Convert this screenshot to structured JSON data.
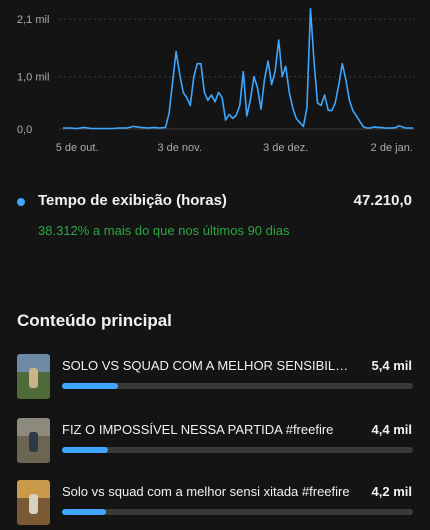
{
  "chart_data": {
    "type": "line",
    "y_ticks": [
      "2,1 mil",
      "1,0 mil",
      "0,0"
    ],
    "y_tick_values": [
      2100,
      1000,
      0
    ],
    "ylim": [
      0,
      2200
    ],
    "x_tick_labels": [
      "5 de out.",
      "3 de nov.",
      "3 de dez.",
      "2 de jan."
    ],
    "x_tick_days": [
      5,
      34,
      64,
      94
    ],
    "xlim": [
      1,
      100
    ],
    "grid": true,
    "line_color": "#3ea6ff",
    "series": [
      {
        "days": [
          1,
          3,
          5,
          7,
          9,
          11,
          13,
          15,
          17,
          19,
          21,
          23,
          25,
          27,
          28,
          30,
          31,
          32,
          33,
          34,
          35,
          36,
          37,
          38,
          39,
          40,
          41,
          42,
          43,
          44,
          45,
          46,
          47,
          48,
          49,
          50,
          51,
          52,
          53,
          54,
          55,
          56,
          57,
          58,
          59,
          60,
          61,
          62,
          63,
          64,
          65,
          66,
          67,
          68,
          69,
          70,
          71,
          72,
          73,
          74,
          75,
          76,
          77,
          78,
          79,
          80,
          81,
          82,
          83,
          84,
          85,
          86,
          87,
          88,
          89,
          90,
          91,
          92,
          93,
          94,
          95,
          96,
          97,
          98,
          99,
          100
        ],
        "values": [
          20,
          20,
          10,
          30,
          10,
          10,
          10,
          10,
          20,
          20,
          50,
          30,
          20,
          30,
          20,
          30,
          300,
          900,
          1480,
          1050,
          700,
          600,
          450,
          1000,
          1250,
          1250,
          700,
          550,
          650,
          520,
          700,
          600,
          170,
          280,
          200,
          260,
          450,
          1100,
          250,
          560,
          1000,
          800,
          380,
          950,
          1300,
          850,
          1100,
          1700,
          1000,
          1200,
          700,
          400,
          200,
          120,
          50,
          400,
          2300,
          1300,
          500,
          450,
          650,
          360,
          350,
          500,
          850,
          1250,
          950,
          550,
          350,
          250,
          140,
          40,
          20,
          20,
          40,
          30,
          30,
          20,
          20,
          20,
          25,
          60,
          40,
          20,
          20,
          20
        ]
      }
    ]
  },
  "metric": {
    "label": "Tempo de exibição (horas)",
    "value": "47.210,0",
    "change": "38.312% a mais do que nos últimos 90 dias"
  },
  "section_title": "Conteúdo principal",
  "content": [
    {
      "title": "SOLO VS SQUAD COM A MELHOR SENSIBILIDADE",
      "value": "5,4 mil",
      "share": 0.16
    },
    {
      "title": "FIZ O IMPOSSÍVEL NESSA PARTIDA #freefire",
      "value": "4,4 mil",
      "share": 0.13
    },
    {
      "title": "Solo vs squad com a melhor sensi xitada #freefire",
      "value": "4,2 mil",
      "share": 0.125
    }
  ],
  "colors": {
    "accent": "#3ea6ff",
    "positive": "#2ba640",
    "background": "#141414"
  }
}
